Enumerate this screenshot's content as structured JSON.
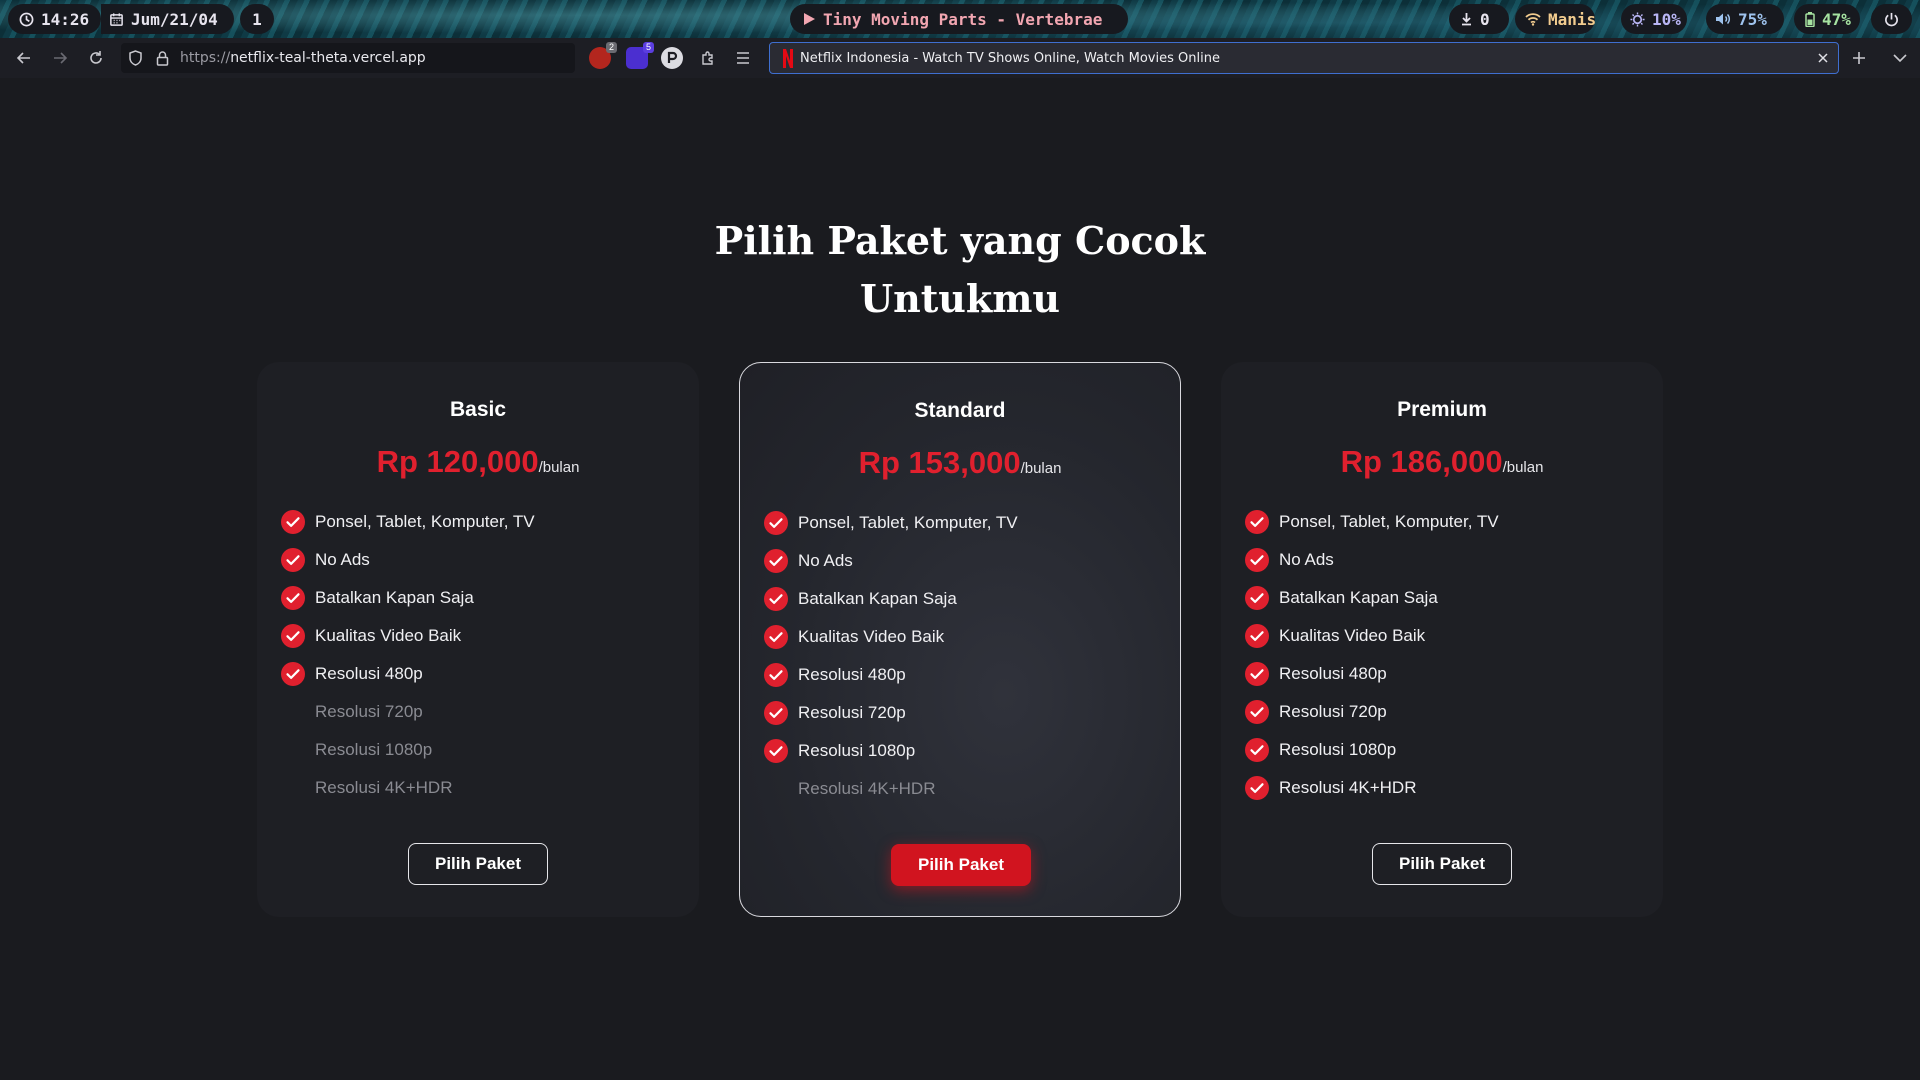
{
  "statusbar": {
    "time": "14:26",
    "date": "Jum/21/04",
    "workspace": "1",
    "media": "Tiny Moving Parts - Vertebrae",
    "downloads": "0",
    "wifi": "Manis",
    "brightness": "10%",
    "volume": "75%",
    "battery": "47%"
  },
  "browser": {
    "url_scheme": "https://",
    "url_host": "netflix-teal-theta.vercel.app",
    "ext_badge_1": "2",
    "ext_badge_2": "5",
    "tab_title": "Netflix Indonesia - Watch TV Shows Online, Watch Movies Online"
  },
  "page": {
    "heading_line1": "Pilih Paket yang Cocok",
    "heading_line2": "Untukmu",
    "plans": [
      {
        "name": "Basic",
        "price": "Rp 120,000",
        "unit": "/bulan",
        "button": "Pilih Paket",
        "features": [
          {
            "label": "Ponsel, Tablet, Komputer, TV",
            "included": true
          },
          {
            "label": "No Ads",
            "included": true
          },
          {
            "label": "Batalkan Kapan Saja",
            "included": true
          },
          {
            "label": "Kualitas Video Baik",
            "included": true
          },
          {
            "label": "Resolusi 480p",
            "included": true
          },
          {
            "label": "Resolusi 720p",
            "included": false
          },
          {
            "label": "Resolusi 1080p",
            "included": false
          },
          {
            "label": "Resolusi 4K+HDR",
            "included": false
          }
        ]
      },
      {
        "name": "Standard",
        "price": "Rp 153,000",
        "unit": "/bulan",
        "button": "Pilih Paket",
        "features": [
          {
            "label": "Ponsel, Tablet, Komputer, TV",
            "included": true
          },
          {
            "label": "No Ads",
            "included": true
          },
          {
            "label": "Batalkan Kapan Saja",
            "included": true
          },
          {
            "label": "Kualitas Video Baik",
            "included": true
          },
          {
            "label": "Resolusi 480p",
            "included": true
          },
          {
            "label": "Resolusi 720p",
            "included": true
          },
          {
            "label": "Resolusi 1080p",
            "included": true
          },
          {
            "label": "Resolusi 4K+HDR",
            "included": false
          }
        ]
      },
      {
        "name": "Premium",
        "price": "Rp 186,000",
        "unit": "/bulan",
        "button": "Pilih Paket",
        "features": [
          {
            "label": "Ponsel, Tablet, Komputer, TV",
            "included": true
          },
          {
            "label": "No Ads",
            "included": true
          },
          {
            "label": "Batalkan Kapan Saja",
            "included": true
          },
          {
            "label": "Kualitas Video Baik",
            "included": true
          },
          {
            "label": "Resolusi 480p",
            "included": true
          },
          {
            "label": "Resolusi 720p",
            "included": true
          },
          {
            "label": "Resolusi 1080p",
            "included": true
          },
          {
            "label": "Resolusi 4K+HDR",
            "included": true
          }
        ]
      }
    ]
  },
  "colors": {
    "accent_red": "#e0202e",
    "button_red": "#d1141f",
    "page_bg": "#1a1b1f"
  }
}
